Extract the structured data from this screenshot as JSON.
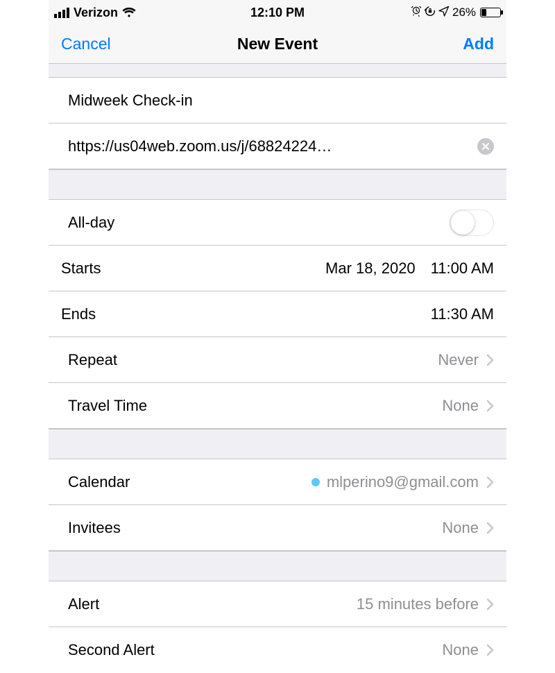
{
  "status_bar": {
    "carrier": "Verizon",
    "time": "12:10 PM",
    "battery_pct": "26%"
  },
  "nav": {
    "cancel": "Cancel",
    "title": "New Event",
    "add": "Add"
  },
  "event": {
    "title": "Midweek Check-in",
    "location": "https://us04web.zoom.us/j/68824224…"
  },
  "allday": {
    "label": "All-day",
    "on": false
  },
  "starts": {
    "label": "Starts",
    "date": "Mar 18, 2020",
    "time": "11:00 AM"
  },
  "ends": {
    "label": "Ends",
    "time": "11:30 AM"
  },
  "repeat": {
    "label": "Repeat",
    "value": "Never"
  },
  "travel": {
    "label": "Travel Time",
    "value": "None"
  },
  "calendar": {
    "label": "Calendar",
    "value": "mlperino9@gmail.com",
    "dot_color": "#5ac8fa"
  },
  "invitees": {
    "label": "Invitees",
    "value": "None"
  },
  "alert": {
    "label": "Alert",
    "value": "15 minutes before"
  },
  "second_alert": {
    "label": "Second Alert",
    "value": "None"
  }
}
